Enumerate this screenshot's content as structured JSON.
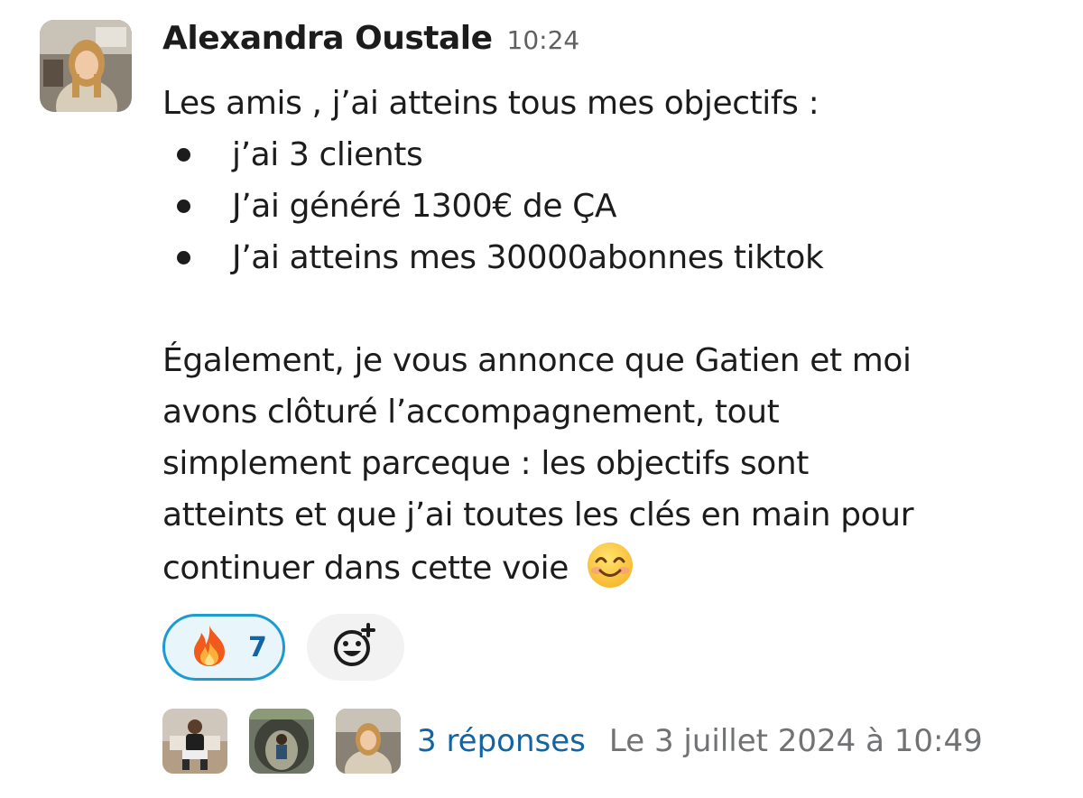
{
  "message": {
    "author": "Alexandra Oustale",
    "time": "10:24",
    "intro": "Les amis , j’ai atteins tous mes objectifs :",
    "bullets": [
      "j’ai 3 clients",
      "J’ai généré 1300€ de ÇA",
      "J’ai atteins mes 30000abonnes tiktok"
    ],
    "paragraph_lines": [
      "Également, je vous annonce que Gatien et moi",
      "avons clôturé l’accompagnement, tout",
      "simplement parceque : les objectifs sont",
      "atteints et que j’ai toutes les clés en main pour",
      "continuer dans cette voie"
    ],
    "trailing_emoji": "smiling-face-emoji"
  },
  "reactions": {
    "fire": {
      "icon": "fire-emoji",
      "count": "7"
    },
    "add_reaction_icon": "add-reaction-icon"
  },
  "thread": {
    "reply_count": "3 réponses",
    "last_reply": "Le 3 juillet 2024 à 10:49"
  },
  "colors": {
    "text": "#1d1c1d",
    "muted": "#616061",
    "link": "#1264a3",
    "reaction_border": "#1d9bd1",
    "reaction_bg": "#e8f5fa"
  }
}
